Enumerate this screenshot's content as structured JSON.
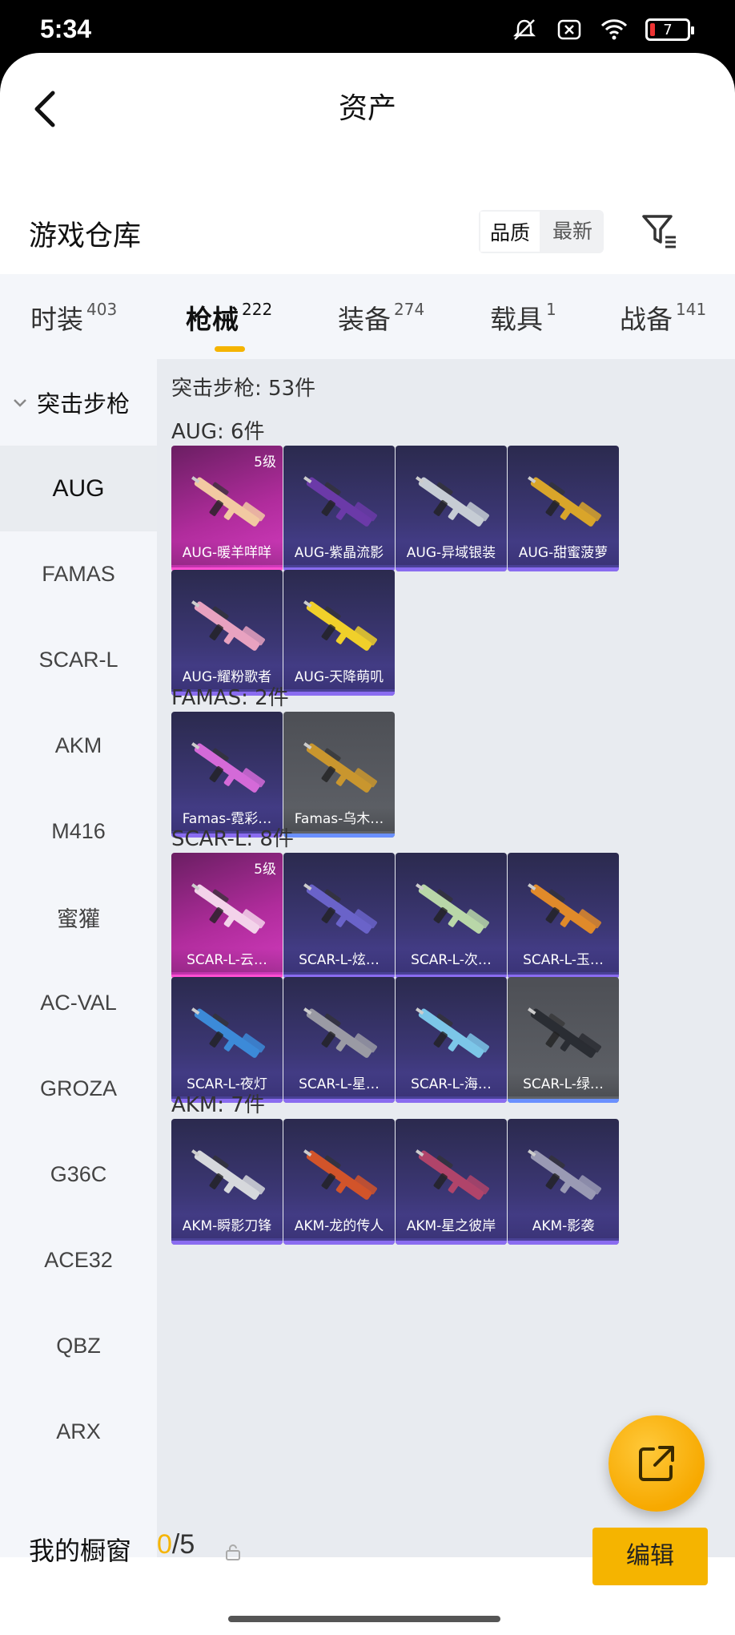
{
  "status_bar": {
    "time": "5:34",
    "battery": "7"
  },
  "header": {
    "title": "资产"
  },
  "section": {
    "title": "游戏仓库",
    "sort_options": [
      "品质",
      "最新"
    ],
    "active_sort": "品质"
  },
  "tabs": [
    {
      "label": "时装",
      "count": "403"
    },
    {
      "label": "枪械",
      "count": "222"
    },
    {
      "label": "装备",
      "count": "274"
    },
    {
      "label": "载具",
      "count": "1"
    },
    {
      "label": "战备",
      "count": "141"
    }
  ],
  "sidebar": {
    "category": "突击步枪",
    "items": [
      "AUG",
      "FAMAS",
      "SCAR-L",
      "AKM",
      "M416",
      "蜜獾",
      "AC-VAL",
      "GROZA",
      "G36C",
      "ACE32",
      "QBZ",
      "ARX"
    ]
  },
  "content": {
    "summary": "突击步枪: 53件",
    "groups": [
      {
        "title": "AUG: 6件",
        "items": [
          {
            "name": "AUG-暖羊咩咩",
            "level": "5级",
            "style": "pink",
            "color": "#f2c9a2"
          },
          {
            "name": "AUG-紫晶流影",
            "style": "blue",
            "color": "#6b3aa8"
          },
          {
            "name": "AUG-异域银装",
            "style": "blue",
            "color": "#c6ccd4"
          },
          {
            "name": "AUG-甜蜜菠萝",
            "style": "blue",
            "color": "#d9a52a"
          },
          {
            "name": "AUG-耀粉歌者",
            "style": "blue",
            "color": "#e8a2c0"
          },
          {
            "name": "AUG-天降萌叽",
            "style": "blue",
            "color": "#f0d02a"
          }
        ]
      },
      {
        "title": "FAMAS: 2件",
        "items": [
          {
            "name": "Famas-霓彩…",
            "style": "blue",
            "color": "#d46ad8"
          },
          {
            "name": "Famas-乌木…",
            "style": "grey",
            "color": "#c9962e"
          }
        ]
      },
      {
        "title": "SCAR-L: 8件",
        "items": [
          {
            "name": "SCAR-L-云…",
            "level": "5级",
            "style": "pink",
            "color": "#f3d3ea"
          },
          {
            "name": "SCAR-L-炫…",
            "style": "blue",
            "color": "#6a63c9"
          },
          {
            "name": "SCAR-L-次…",
            "style": "blue",
            "color": "#b9d7a8"
          },
          {
            "name": "SCAR-L-玉…",
            "style": "blue",
            "color": "#e08a2a"
          },
          {
            "name": "SCAR-L-夜灯",
            "style": "blue",
            "color": "#3c8ad8"
          },
          {
            "name": "SCAR-L-星…",
            "style": "blue",
            "color": "#9a9aa4"
          },
          {
            "name": "SCAR-L-海…",
            "style": "blue",
            "color": "#7cc6e8"
          },
          {
            "name": "SCAR-L-绿…",
            "style": "grey",
            "color": "#2a2d33"
          }
        ]
      },
      {
        "title": "AKM: 7件",
        "items": [
          {
            "name": "AKM-瞬影刀锋",
            "style": "blue",
            "color": "#d6d8dc"
          },
          {
            "name": "AKM-龙的传人",
            "style": "blue",
            "color": "#d2542a"
          },
          {
            "name": "AKM-星之彼岸",
            "style": "blue",
            "color": "#b0446a"
          },
          {
            "name": "AKM-影袭",
            "style": "blue",
            "color": "#9a9ab4"
          }
        ]
      }
    ]
  },
  "bottom_bar": {
    "label": "我的橱窗",
    "used": "0",
    "total": "/5",
    "edit_label": "编辑"
  }
}
